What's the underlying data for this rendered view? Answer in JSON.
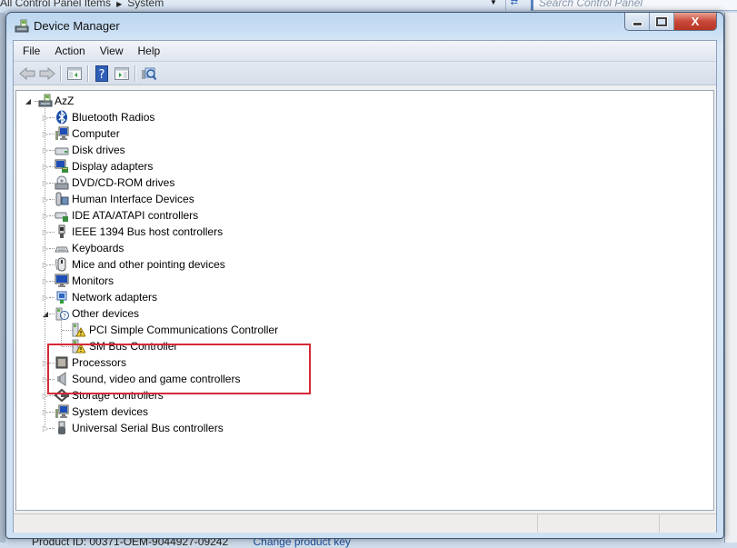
{
  "background_window": {
    "breadcrumb": [
      "All Control Panel Items",
      "System"
    ],
    "search_placeholder": "Search Control Panel",
    "footer_text": "Product ID: 00371-OEM-9044927-09242",
    "footer_link": "Change product key"
  },
  "window": {
    "title": "Device Manager",
    "caption": {
      "minimize": "minimize",
      "maximize": "maximize",
      "close_label": "X"
    }
  },
  "menu": [
    {
      "label": "File"
    },
    {
      "label": "Action"
    },
    {
      "label": "View"
    },
    {
      "label": "Help"
    }
  ],
  "toolbar": [
    {
      "icon": "back-arrow-icon",
      "tooltip": "Back"
    },
    {
      "icon": "forward-arrow-icon",
      "tooltip": "Forward"
    },
    {
      "icon": "show-hide-console-tree-icon",
      "tooltip": "Show/Hide Console Tree"
    },
    {
      "icon": "help-icon",
      "tooltip": "Help"
    },
    {
      "icon": "show-hide-action-pane-icon",
      "tooltip": "Show/Hide Action Pane"
    },
    {
      "icon": "scan-hardware-icon",
      "tooltip": "Scan for hardware changes"
    }
  ],
  "tree": {
    "root": {
      "label": "AzZ",
      "expanded": true,
      "icon": "computer-root-icon"
    },
    "categories": [
      {
        "label": "Bluetooth Radios",
        "icon": "bluetooth-icon",
        "expanded": false
      },
      {
        "label": "Computer",
        "icon": "computer-icon",
        "expanded": false
      },
      {
        "label": "Disk drives",
        "icon": "disk-drive-icon",
        "expanded": false
      },
      {
        "label": "Display adapters",
        "icon": "display-adapter-icon",
        "expanded": false
      },
      {
        "label": "DVD/CD-ROM drives",
        "icon": "dvd-drive-icon",
        "expanded": false
      },
      {
        "label": "Human Interface Devices",
        "icon": "hid-icon",
        "expanded": false
      },
      {
        "label": "IDE ATA/ATAPI controllers",
        "icon": "ide-controller-icon",
        "expanded": false
      },
      {
        "label": "IEEE 1394 Bus host controllers",
        "icon": "firewire-icon",
        "expanded": false
      },
      {
        "label": "Keyboards",
        "icon": "keyboard-icon",
        "expanded": false
      },
      {
        "label": "Mice and other pointing devices",
        "icon": "mouse-icon",
        "expanded": false
      },
      {
        "label": "Monitors",
        "icon": "monitor-icon",
        "expanded": false
      },
      {
        "label": "Network adapters",
        "icon": "network-adapter-icon",
        "expanded": false
      },
      {
        "label": "Other devices",
        "icon": "unknown-device-icon",
        "expanded": true,
        "children": [
          {
            "label": "PCI Simple Communications Controller",
            "icon": "warning-device-icon",
            "status": "warning"
          },
          {
            "label": "SM Bus Controller",
            "icon": "warning-device-icon",
            "status": "warning"
          }
        ]
      },
      {
        "label": "Processors",
        "icon": "processor-icon",
        "expanded": false
      },
      {
        "label": "Sound, video and game controllers",
        "icon": "speaker-icon",
        "expanded": false
      },
      {
        "label": "Storage controllers",
        "icon": "storage-controller-icon",
        "expanded": false
      },
      {
        "label": "System devices",
        "icon": "system-device-icon",
        "expanded": false
      },
      {
        "label": "Universal Serial Bus controllers",
        "icon": "usb-icon",
        "expanded": false
      }
    ]
  },
  "annotation": {
    "highlight_color": "#d42a35",
    "target": "Other devices"
  },
  "colors": {
    "close_button": "#c9483a",
    "window_frame": "#c9def4"
  }
}
